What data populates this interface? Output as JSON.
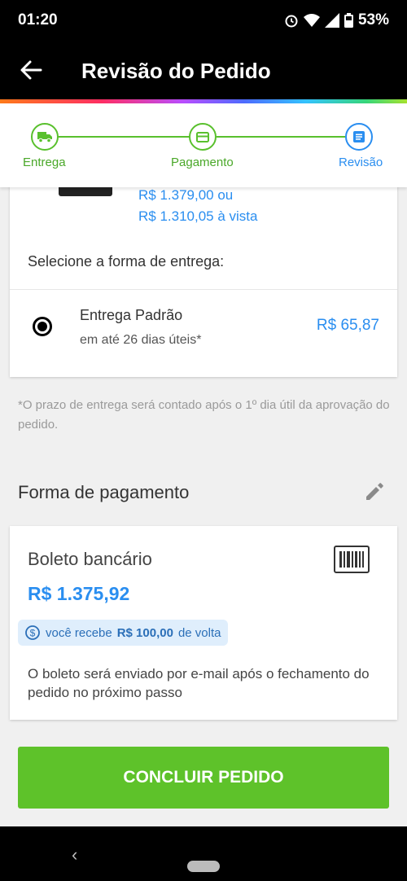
{
  "status_bar": {
    "time": "01:20",
    "battery": "53%"
  },
  "header": {
    "title": "Revisão do Pedido"
  },
  "stepper": {
    "steps": [
      {
        "label": "Entrega",
        "state": "done"
      },
      {
        "label": "Pagamento",
        "state": "done"
      },
      {
        "label": "Revisão",
        "state": "active"
      }
    ]
  },
  "product": {
    "price_installments": "R$ 1.379,00 ou",
    "price_cash": "R$ 1.310,05 à vista"
  },
  "delivery": {
    "section_title": "Selecione a forma de entrega:",
    "option_name": "Entrega Padrão",
    "option_eta": "em até 26 dias úteis*",
    "option_price": "R$ 65,87",
    "note": "*O prazo de entrega será contado após o 1º dia útil da aprovação do pedido."
  },
  "payment": {
    "heading": "Forma de pagamento",
    "method": "Boleto bancário",
    "amount": "R$ 1.375,92",
    "cashback_prefix": "você recebe",
    "cashback_value": "R$ 100,00",
    "cashback_suffix": "de volta",
    "info": "O boleto será enviado por e-mail após o fechamento do pedido no próximo passo"
  },
  "cta": {
    "label": "CONCLUIR PEDIDO"
  },
  "colors": {
    "accent_green": "#5ec22a",
    "accent_blue": "#2a8ef0"
  }
}
